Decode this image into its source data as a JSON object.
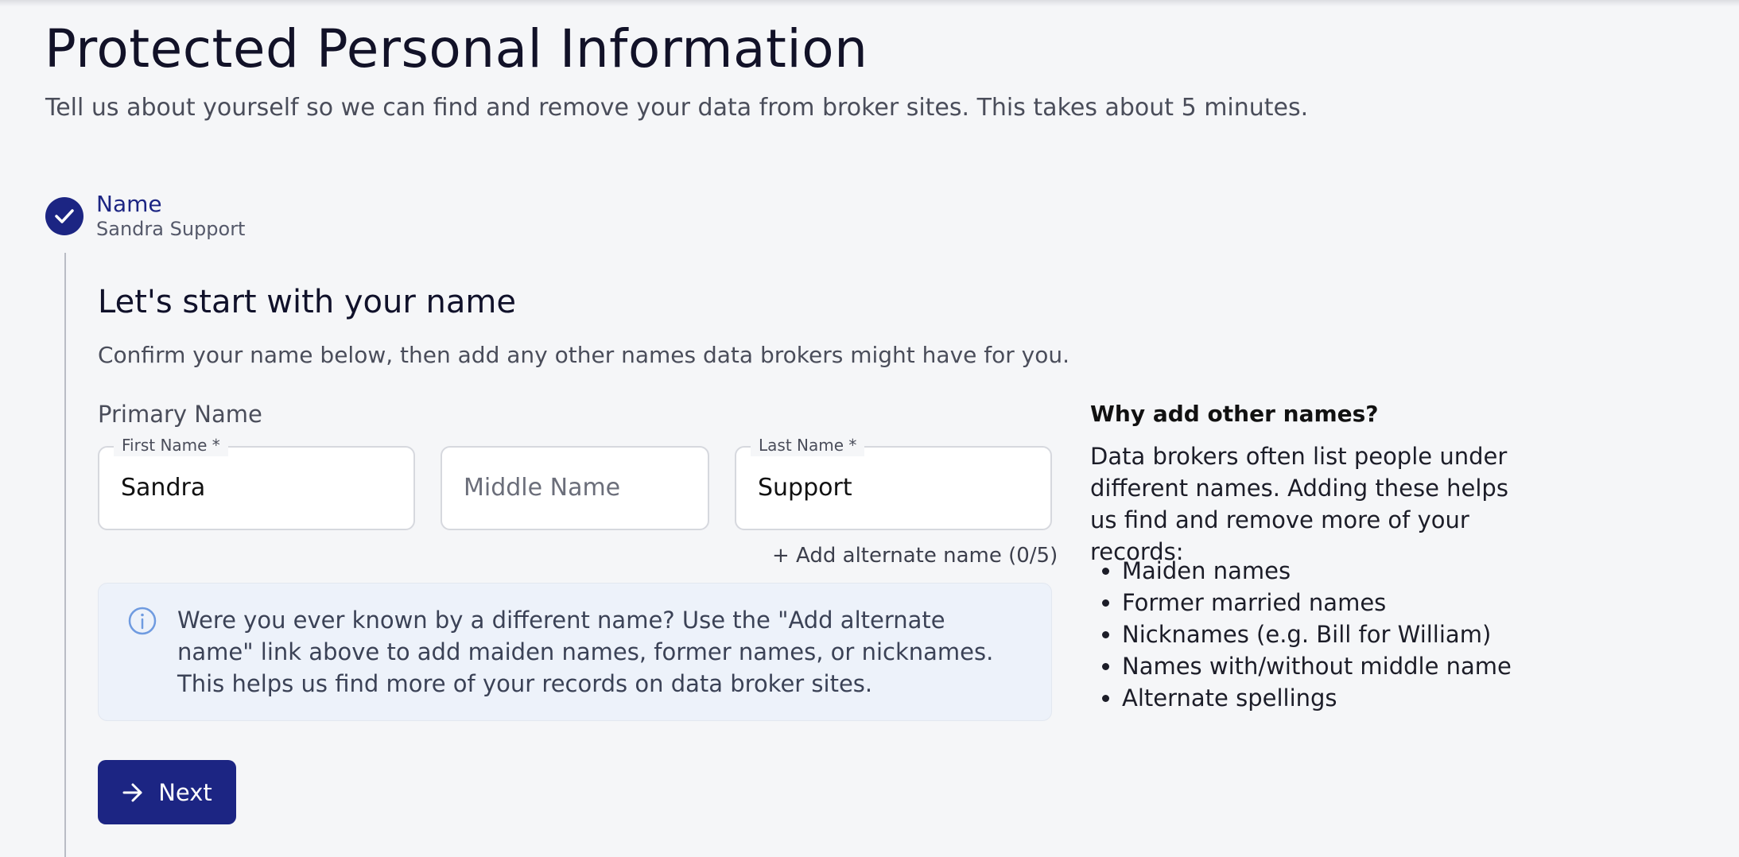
{
  "header": {
    "title": "Protected Personal Information",
    "subtitle": "Tell us about yourself so we can find and remove your data from broker sites. This takes about 5 minutes."
  },
  "step": {
    "icon": "check-icon",
    "name": "Name",
    "value": "Sandra Support"
  },
  "section": {
    "title": "Let's start with your name",
    "description": "Confirm your name below, then add any other names data brokers might have for you."
  },
  "form": {
    "primary_label": "Primary Name",
    "first_name": {
      "label": "First Name *",
      "value": "Sandra"
    },
    "middle_name": {
      "placeholder": "Middle Name",
      "value": ""
    },
    "last_name": {
      "label": "Last Name *",
      "value": "Support"
    },
    "add_alternate": "+ Add alternate name (0/5)"
  },
  "info": {
    "icon": "info-icon",
    "text": "Were you ever known by a different name? Use the \"Add alternate name\" link above to add maiden names, former names, or nicknames. This helps us find more of your records on data broker sites."
  },
  "next_button": {
    "label": "Next",
    "icon": "arrow-right-icon"
  },
  "sidebar": {
    "title": "Why add other names?",
    "text": "Data brokers often list people under different names. Adding these helps us find and remove more of your records:",
    "items": [
      "Maiden names",
      "Former married names",
      "Nicknames (e.g. Bill for William)",
      "Names with/without middle name",
      "Alternate spellings"
    ]
  },
  "colors": {
    "accent": "#1c2583",
    "background": "#f5f6f8",
    "info_background": "#edf2fa"
  }
}
